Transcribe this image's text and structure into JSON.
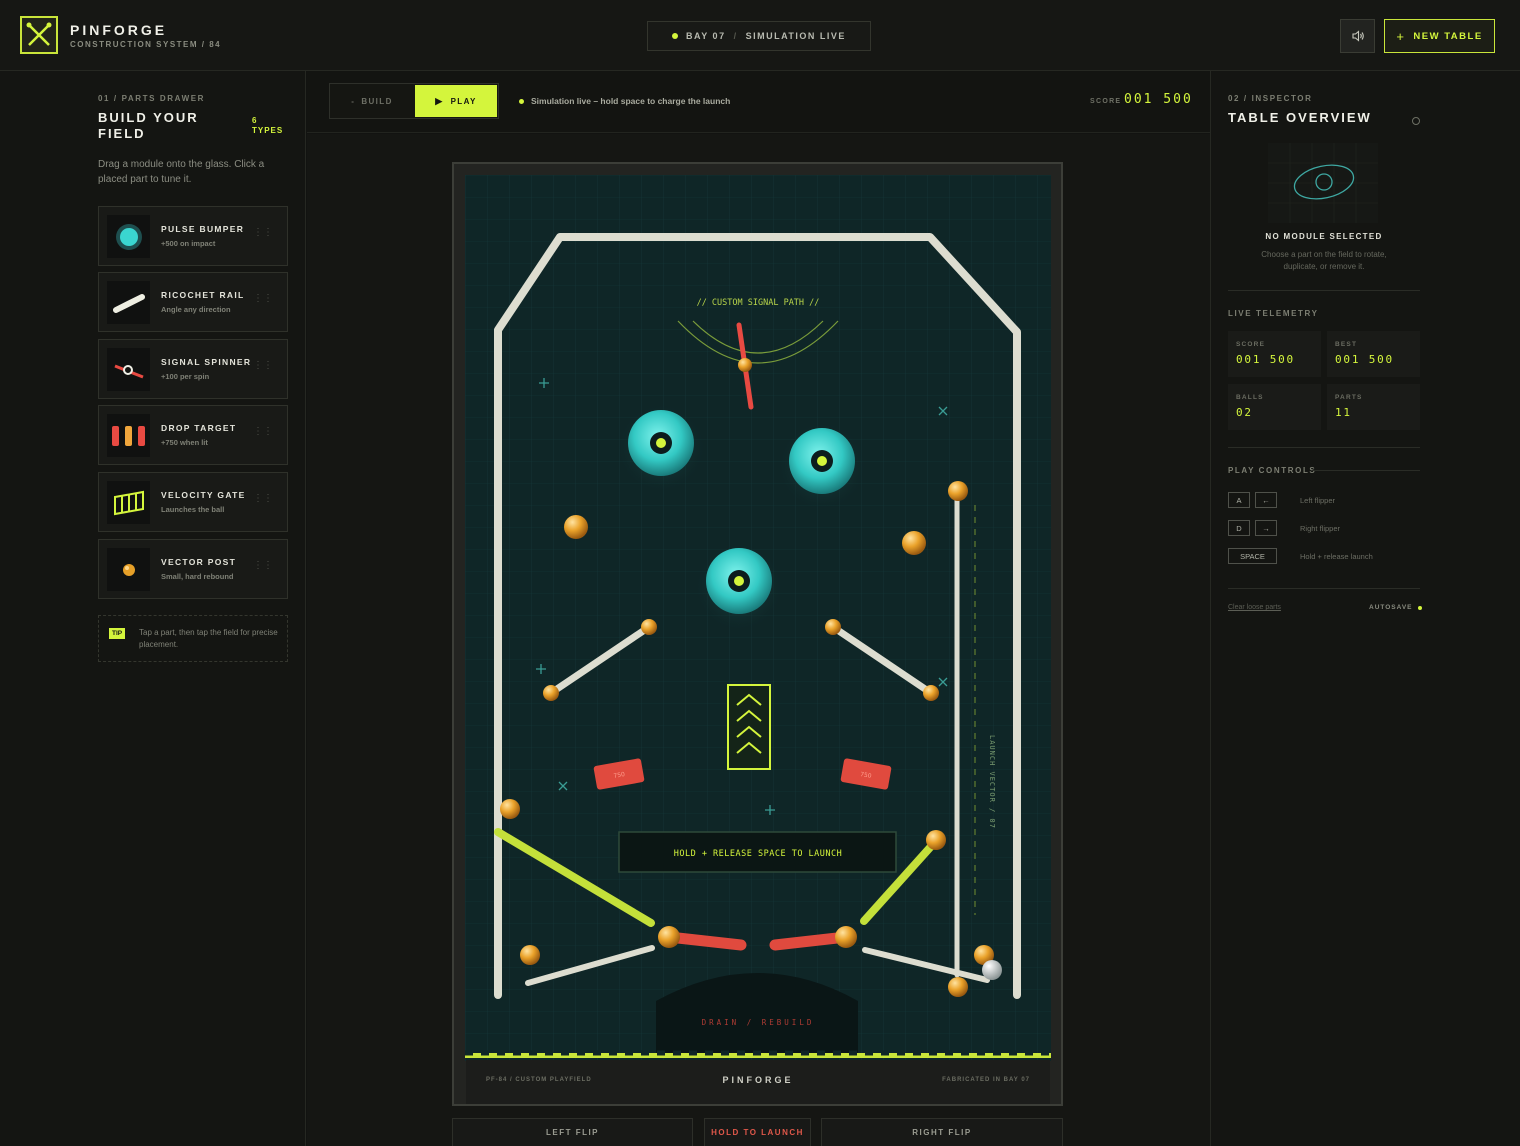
{
  "header": {
    "brand": "PINFORGE",
    "brand_sub": "CONSTRUCTION SYSTEM / 84",
    "bay": "BAY 07",
    "separator": "/",
    "status": "SIMULATION LIVE",
    "new_table": "NEW TABLE",
    "new_table_icon": "plus-icon",
    "sound_icon": "speaker-icon"
  },
  "parts_drawer": {
    "section": "01 / PARTS DRAWER",
    "title": "BUILD YOUR FIELD",
    "count": "6 TYPES",
    "description": "Drag a module onto the glass. Click a placed part to tune it.",
    "items": [
      {
        "name": "PULSE BUMPER",
        "desc": "+500 on impact",
        "icon": "pulse-bumper-icon"
      },
      {
        "name": "RICOCHET RAIL",
        "desc": "Angle any direction",
        "icon": "ricochet-rail-icon"
      },
      {
        "name": "SIGNAL SPINNER",
        "desc": "+100 per spin",
        "icon": "signal-spinner-icon"
      },
      {
        "name": "DROP TARGET",
        "desc": "+750 when lit",
        "icon": "drop-target-icon"
      },
      {
        "name": "VELOCITY GATE",
        "desc": "Launches the ball",
        "icon": "velocity-gate-icon"
      },
      {
        "name": "VECTOR POST",
        "desc": "Small, hard rebound",
        "icon": "vector-post-icon"
      }
    ],
    "tip_badge": "TIP",
    "tip_text": "Tap a part, then tap the field for precise placement."
  },
  "toolbar": {
    "build": "BUILD",
    "play": "PLAY",
    "message": "Simulation live – hold space to charge the launch",
    "score_label": "SCORE",
    "score_value": "001 500"
  },
  "playfield": {
    "signal_path": "// CUSTOM SIGNAL PATH //",
    "launch_prompt": "HOLD + RELEASE SPACE TO LAUNCH",
    "drain": "DRAIN / REBUILD",
    "launch_vector": "LAUNCH VECTOR / 07",
    "target_value_left": "750",
    "target_value_right": "750",
    "footer_left": "PF-84 / CUSTOM PLAYFIELD",
    "footer_mid": "PINFORGE",
    "footer_right": "FABRICATED IN BAY 07"
  },
  "controls": {
    "left": "LEFT FLIP",
    "launch": "HOLD TO LAUNCH",
    "right": "RIGHT FLIP"
  },
  "inspector": {
    "section": "02 / INSPECTOR",
    "title": "TABLE OVERVIEW",
    "no_module": "NO MODULE SELECTED",
    "no_module_sub": "Choose a part on the field to rotate, duplicate, or remove it.",
    "telemetry_label": "LIVE TELEMETRY",
    "telemetry": [
      {
        "label": "SCORE",
        "value": "001 500"
      },
      {
        "label": "BEST",
        "value": "001 500"
      },
      {
        "label": "BALLS",
        "value": "02"
      },
      {
        "label": "PARTS",
        "value": "11"
      }
    ],
    "controls_label": "PLAY CONTROLS",
    "controls": [
      {
        "key": "A",
        "alt": "←",
        "desc": "Left flipper"
      },
      {
        "key": "D",
        "alt": "→",
        "desc": "Right flipper"
      },
      {
        "key": "SPACE",
        "alt": "",
        "desc": "Hold + release launch"
      }
    ],
    "clear": "Clear loose parts",
    "autosave": "AUTOSAVE"
  },
  "colors": {
    "accent": "#d4f53c",
    "bumper": "#3ad6d0",
    "target": "#e04a3e",
    "field": "#0f2a2c"
  }
}
